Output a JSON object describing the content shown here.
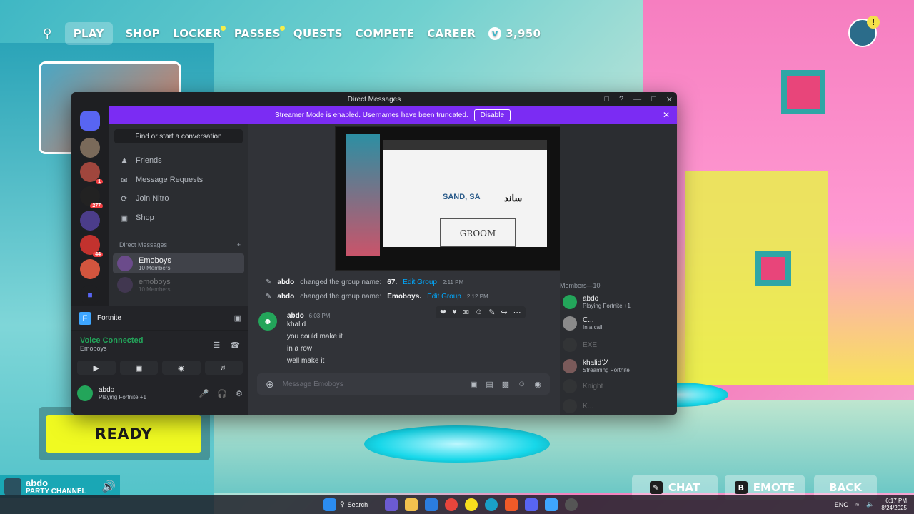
{
  "fortnite": {
    "nav": [
      "PLAY",
      "SHOP",
      "LOCKER",
      "PASSES",
      "QUESTS",
      "COMPETE",
      "CAREER"
    ],
    "vbucks": "3,950",
    "vb_symbol": "V",
    "alert_symbol": "!",
    "ready": "READY",
    "party_name": "abdo",
    "party_channel": "PARTY CHANNEL",
    "chat": "CHAT",
    "emote": "EMOTE",
    "back": "BACK",
    "chat_key": "",
    "emote_key": "B"
  },
  "taskbar": {
    "search": "Search",
    "lang": "ENG",
    "time": "6:17 PM",
    "date": "8/24/2025"
  },
  "discord": {
    "title": "Direct Messages",
    "streamer_notice": "Streamer Mode is enabled. Usernames have been truncated.",
    "disable": "Disable",
    "servers": [
      {
        "badge": ""
      },
      {
        "badge": "1"
      },
      {
        "badge": "277"
      },
      {
        "badge": ""
      },
      {
        "badge": "44"
      },
      {
        "badge": ""
      }
    ],
    "find_placeholder": "Find or start a conversation",
    "nav": [
      "Friends",
      "Message Requests",
      "Join Nitro",
      "Shop"
    ],
    "dm_header": "Direct Messages",
    "dms": [
      {
        "name": "Emoboys",
        "sub": "10 Members"
      },
      {
        "name": "emoboys",
        "sub": "10 Members"
      }
    ],
    "voice": {
      "app": "Fortnite",
      "status": "Voice Connected",
      "channel": "Emoboys"
    },
    "user": {
      "name": "abdo",
      "status": "Playing Fortnite +1"
    },
    "video": {
      "sand": "SAND, SA",
      "arabic": "ساند",
      "groom": "GROOM"
    },
    "system_msgs": [
      {
        "user": "abdo",
        "text": "changed the group name:",
        "value": "67.",
        "link": "Edit Group",
        "time": "2:11 PM"
      },
      {
        "user": "abdo",
        "text": "changed the group name:",
        "value": "Emoboys.",
        "link": "Edit Group",
        "time": "2:12 PM"
      }
    ],
    "message": {
      "user": "abdo",
      "time": "6:03 PM",
      "lines": [
        "khalid",
        "you could make it",
        "in a row",
        "well make it"
      ]
    },
    "composer_placeholder": "Message Emoboys",
    "members_header": "Members—10",
    "members": [
      {
        "name": "abdo",
        "status": "Playing Fortnite +1"
      },
      {
        "name": "C...",
        "status": "In a call"
      },
      {
        "name": "EXE",
        "status": ""
      },
      {
        "name": "khalidツ",
        "status": "Streaming Fortnite"
      },
      {
        "name": "Knight",
        "status": ""
      },
      {
        "name": "K...",
        "status": ""
      }
    ]
  },
  "colors": {
    "accent": "#5865f2",
    "streamer_bar": "#7b2cf3",
    "ready": "#f0fa21",
    "online": "#23a55a"
  }
}
